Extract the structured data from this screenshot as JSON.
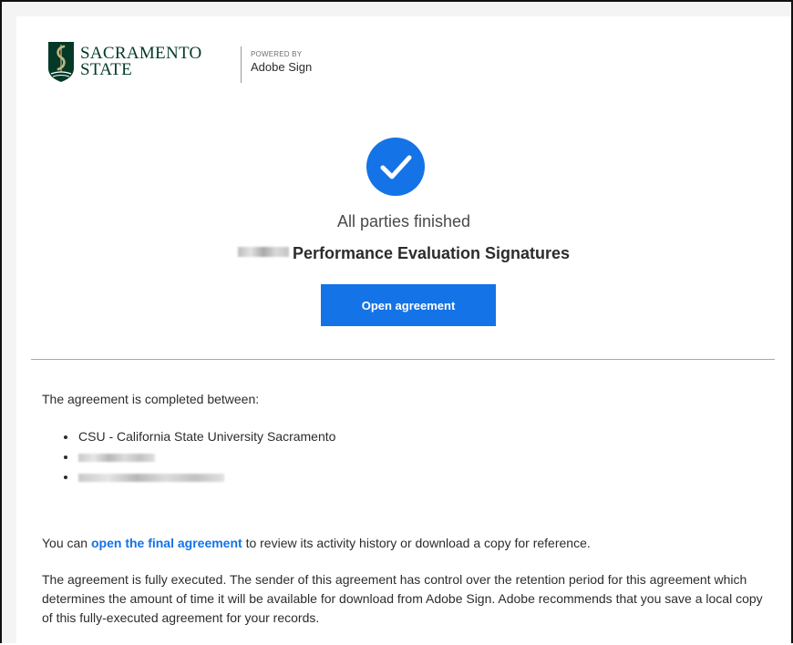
{
  "brand": {
    "line1": "SACRAMENTO",
    "line2": "STATE",
    "powered_by": "POWERED BY",
    "powered_name": "Adobe Sign",
    "color": "#043927"
  },
  "status": {
    "message": "All parties finished",
    "title": "Performance Evaluation Signatures",
    "accent": "#1473e6"
  },
  "actions": {
    "open_label": "Open agreement"
  },
  "agreement": {
    "intro": "The agreement is completed between:",
    "parties": [
      "CSU - California State University Sacramento"
    ],
    "final_prefix": "You can ",
    "final_link": "open the final agreement",
    "final_suffix": " to review its activity history or download a copy for reference.",
    "retention_note": "The agreement is fully executed. The sender of this agreement has control over the retention period for this agreement which determines the amount of time it will be available for download from Adobe Sign. Adobe recommends that you save a local copy of this fully-executed agreement for your records."
  },
  "icons": {
    "seal": "sac-state-seal-icon",
    "check": "check-circle-icon"
  }
}
